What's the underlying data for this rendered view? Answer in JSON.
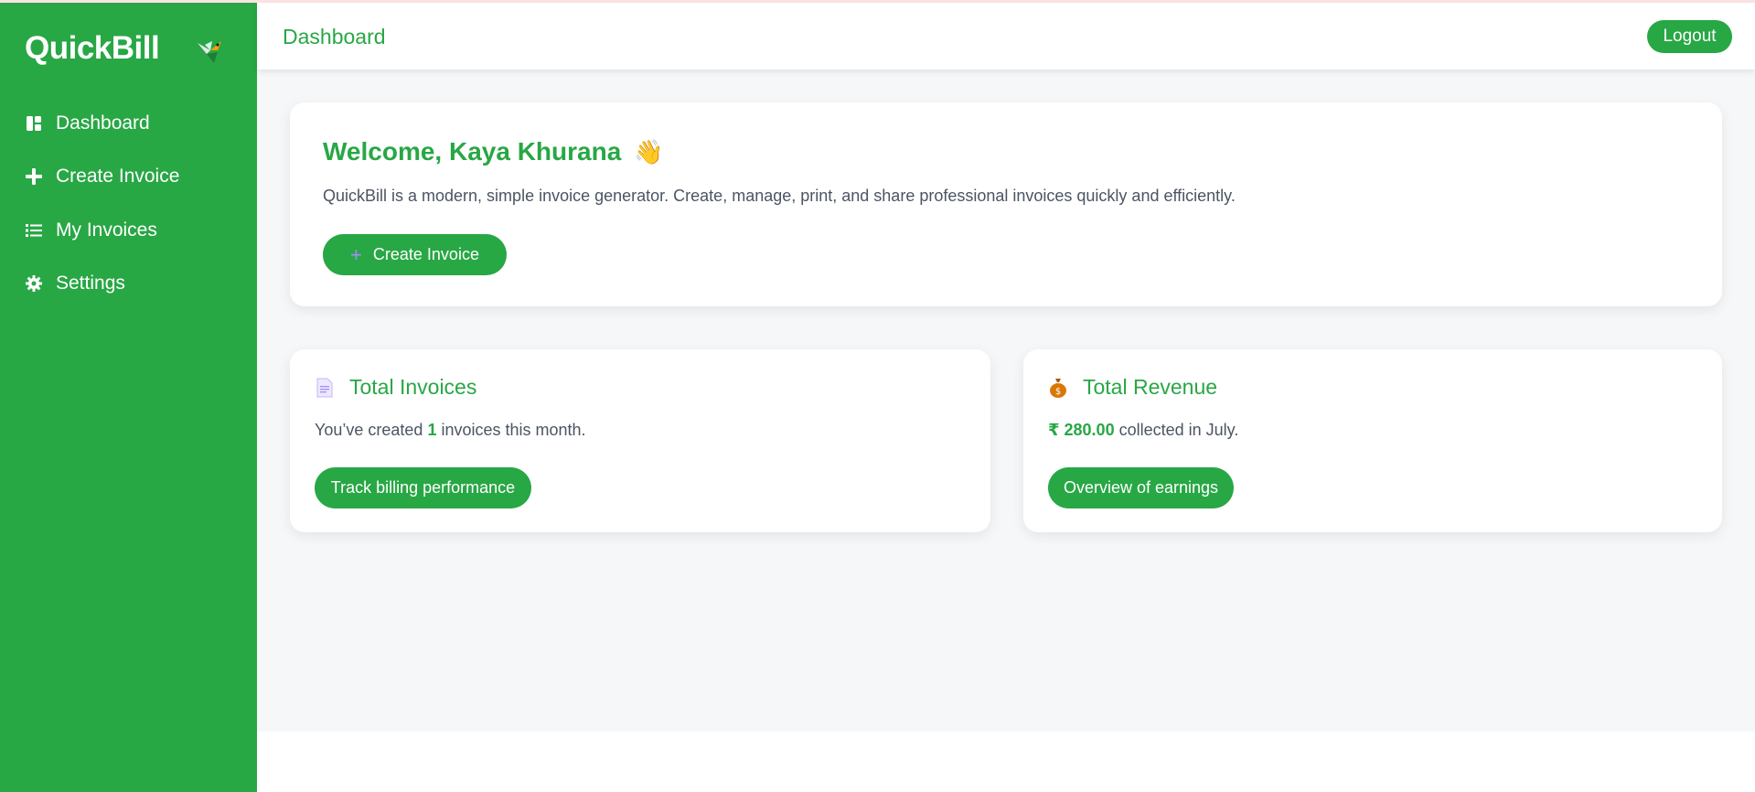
{
  "app": {
    "brand": "QuickBill"
  },
  "sidebar": {
    "items": [
      {
        "label": "Dashboard",
        "icon": "dashboard-icon"
      },
      {
        "label": "Create Invoice",
        "icon": "plus-icon"
      },
      {
        "label": "My Invoices",
        "icon": "list-icon"
      },
      {
        "label": "Settings",
        "icon": "gear-icon"
      }
    ]
  },
  "header": {
    "title": "Dashboard",
    "logout_label": "Logout"
  },
  "welcome": {
    "title": "Welcome, Kaya Khurana",
    "wave": "👋",
    "description": "QuickBill is a modern, simple invoice generator. Create, manage, print, and share professional invoices quickly and efficiently.",
    "button_label": "Create Invoice"
  },
  "stats": {
    "invoices": {
      "title": "Total Invoices",
      "prefix": "You’ve created ",
      "count": "1",
      "suffix": " invoices this month.",
      "button_label": "Track billing performance"
    },
    "revenue": {
      "title": "Total Revenue",
      "amount": "₹ 280.00",
      "suffix": " collected in July.",
      "button_label": "Overview of earnings"
    }
  },
  "colors": {
    "primary": "#28a745",
    "background": "#f6f7f9"
  }
}
